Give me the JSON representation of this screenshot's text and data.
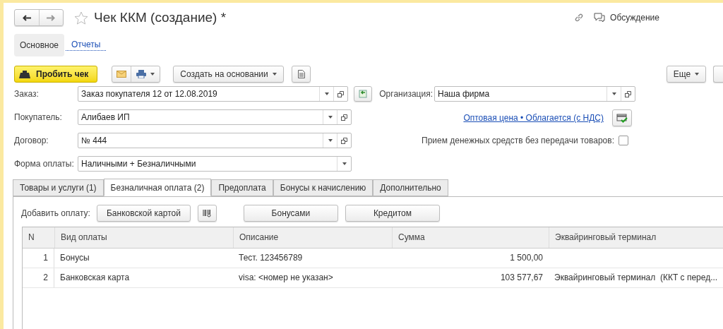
{
  "header": {
    "title": "Чек ККМ (создание) *",
    "discussion": "Обсуждение"
  },
  "section_tabs": [
    {
      "label": "Основное",
      "selected": true
    },
    {
      "label": "Отчеты",
      "selected": false
    }
  ],
  "toolbar": {
    "primary": "Пробить чек",
    "create_based_on": "Создать на основании",
    "more": "Еще"
  },
  "left_fields": [
    {
      "label": "Заказ:",
      "value": "Заказ покупателя 12 от 12.08.2019",
      "kind": "select_open_extra"
    },
    {
      "label": "Покупатель:",
      "value": "Алибаев ИП",
      "kind": "select_open"
    },
    {
      "label": "Договор:",
      "value": "№ 444",
      "kind": "select_open"
    },
    {
      "label": "Форма оплаты:",
      "value": "Наличными + Безналичными",
      "kind": "select"
    }
  ],
  "organization": {
    "label": "Организация:",
    "value": "Наша фирма"
  },
  "price_link": "Оптовая цена • Облагается (с НДС)",
  "cash_checkbox": {
    "label": "Прием денежных средств без передачи товаров:",
    "checked": false
  },
  "tabs": [
    {
      "label": "Товары и услуги (1)",
      "selected": false
    },
    {
      "label": "Безналичная оплата (2)",
      "selected": true
    },
    {
      "label": "Предоплата",
      "selected": false
    },
    {
      "label": "Бонусы к начислению",
      "selected": false
    },
    {
      "label": "Дополнительно",
      "selected": false
    }
  ],
  "add_payment": {
    "label": "Добавить оплату:",
    "card_button": "Банковской картой",
    "buttons": [
      "Бонусами",
      "Кредитом"
    ]
  },
  "table": {
    "columns": [
      "N",
      "Вид оплаты",
      "Описание",
      "Сумма",
      "Эквайринговый терминал"
    ],
    "rows": [
      [
        "1",
        "Бонусы",
        "Тест. 123456789",
        "1 500,00",
        ""
      ],
      [
        "2",
        "Банковская карта",
        "visa: <номер не указан>",
        "103 577,67",
        "Эквайринговый терминал  (ККТ с перед..."
      ]
    ]
  }
}
